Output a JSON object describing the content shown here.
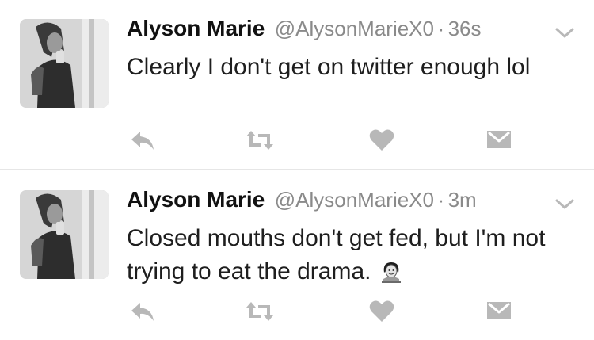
{
  "tweets": [
    {
      "author_name": "Alyson Marie",
      "handle": "@AlysonMarieX0",
      "separator": "·",
      "time": "36s",
      "text": "Clearly I don't get on twitter enough lol",
      "emoji": ""
    },
    {
      "author_name": "Alyson Marie",
      "handle": "@AlysonMarieX0",
      "separator": "·",
      "time": "3m",
      "text": "Closed mouths don't get fed, but I'm not trying to eat the drama.",
      "emoji": "woman-at-desk-emoji"
    }
  ],
  "colors": {
    "icon_gray": "#b8b8b8",
    "meta_gray": "#8a8a8a",
    "divider": "#e6e6e6"
  },
  "icons": [
    "reply-icon",
    "retweet-icon",
    "like-icon",
    "direct-message-icon",
    "chevron-down-icon"
  ]
}
